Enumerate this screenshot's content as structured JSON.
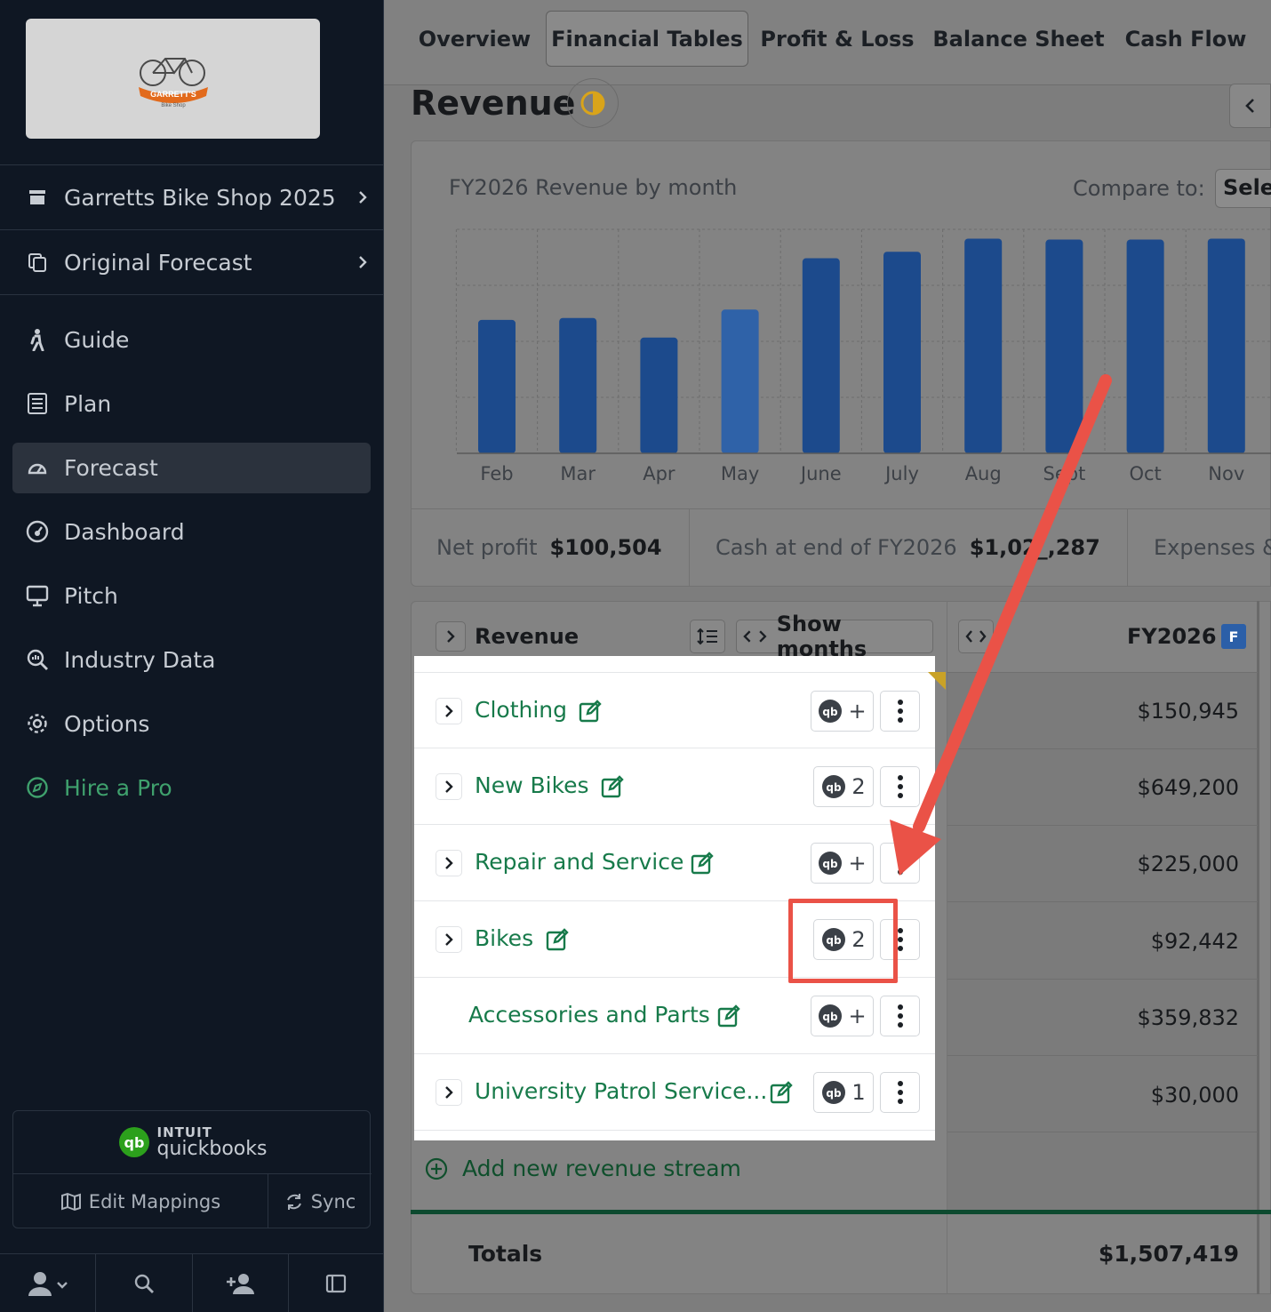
{
  "sidebar": {
    "company": "Garretts Bike Shop 2025",
    "scenario": "Original Forecast",
    "nav": [
      "Guide",
      "Plan",
      "Forecast",
      "Dashboard",
      "Pitch",
      "Industry Data",
      "Options"
    ],
    "hire": "Hire a Pro",
    "qb_intuit": "INTUIT",
    "qb_name": "quickbooks",
    "edit_mappings": "Edit Mappings",
    "sync": "Sync"
  },
  "logo": {
    "line1": "GARRETT'S",
    "line2": "Bike Shop"
  },
  "tabs": [
    "Overview",
    "Financial Tables",
    "Profit & Loss",
    "Balance Sheet",
    "Cash Flow"
  ],
  "page_title": "Revenue",
  "chart_card": {
    "title": "FY2026 Revenue by month",
    "compare_label": "Compare to:",
    "compare_value": "Sele"
  },
  "chart_data": {
    "type": "bar",
    "categories": [
      "Feb",
      "Mar",
      "Apr",
      "May",
      "June",
      "July",
      "Aug",
      "Sept",
      "Oct",
      "Nov"
    ],
    "values": [
      143,
      145,
      124,
      154,
      209,
      216,
      230,
      229,
      229,
      230
    ],
    "grid": true,
    "colors": {
      "bar": "#1c4a8c",
      "highlight": "#2f62a8"
    }
  },
  "kpis": [
    {
      "label": "Net profit",
      "value": "$100,504"
    },
    {
      "label": "Cash at end of FY2026",
      "value": "$1,02_,287"
    },
    {
      "label": "Expenses &",
      "value": ""
    }
  ],
  "table": {
    "header_label": "Revenue",
    "show_months": "Show months",
    "year": "FY2026",
    "year_badge": "F",
    "rows": [
      {
        "name": "Clothing",
        "chip": "+",
        "amount": "$150,945"
      },
      {
        "name": "New Bikes",
        "chip": "2",
        "amount": "$649,200"
      },
      {
        "name": "Repair and Service",
        "chip": "+",
        "amount": "$225,000"
      },
      {
        "name": "Bikes",
        "chip": "2",
        "amount": "$92,442"
      },
      {
        "name": "Accessories and Parts",
        "chip": "+",
        "amount": "$359,832"
      },
      {
        "name": "University Patrol Service...",
        "chip": "1",
        "amount": "$30,000"
      }
    ],
    "add_label": "Add new revenue stream",
    "totals_label": "Totals",
    "totals_value": "$1,507,419"
  },
  "colors": {
    "accent_green": "#177a4a",
    "annotation_red": "#ea5247",
    "sidebar_bg": "#0f1723"
  }
}
